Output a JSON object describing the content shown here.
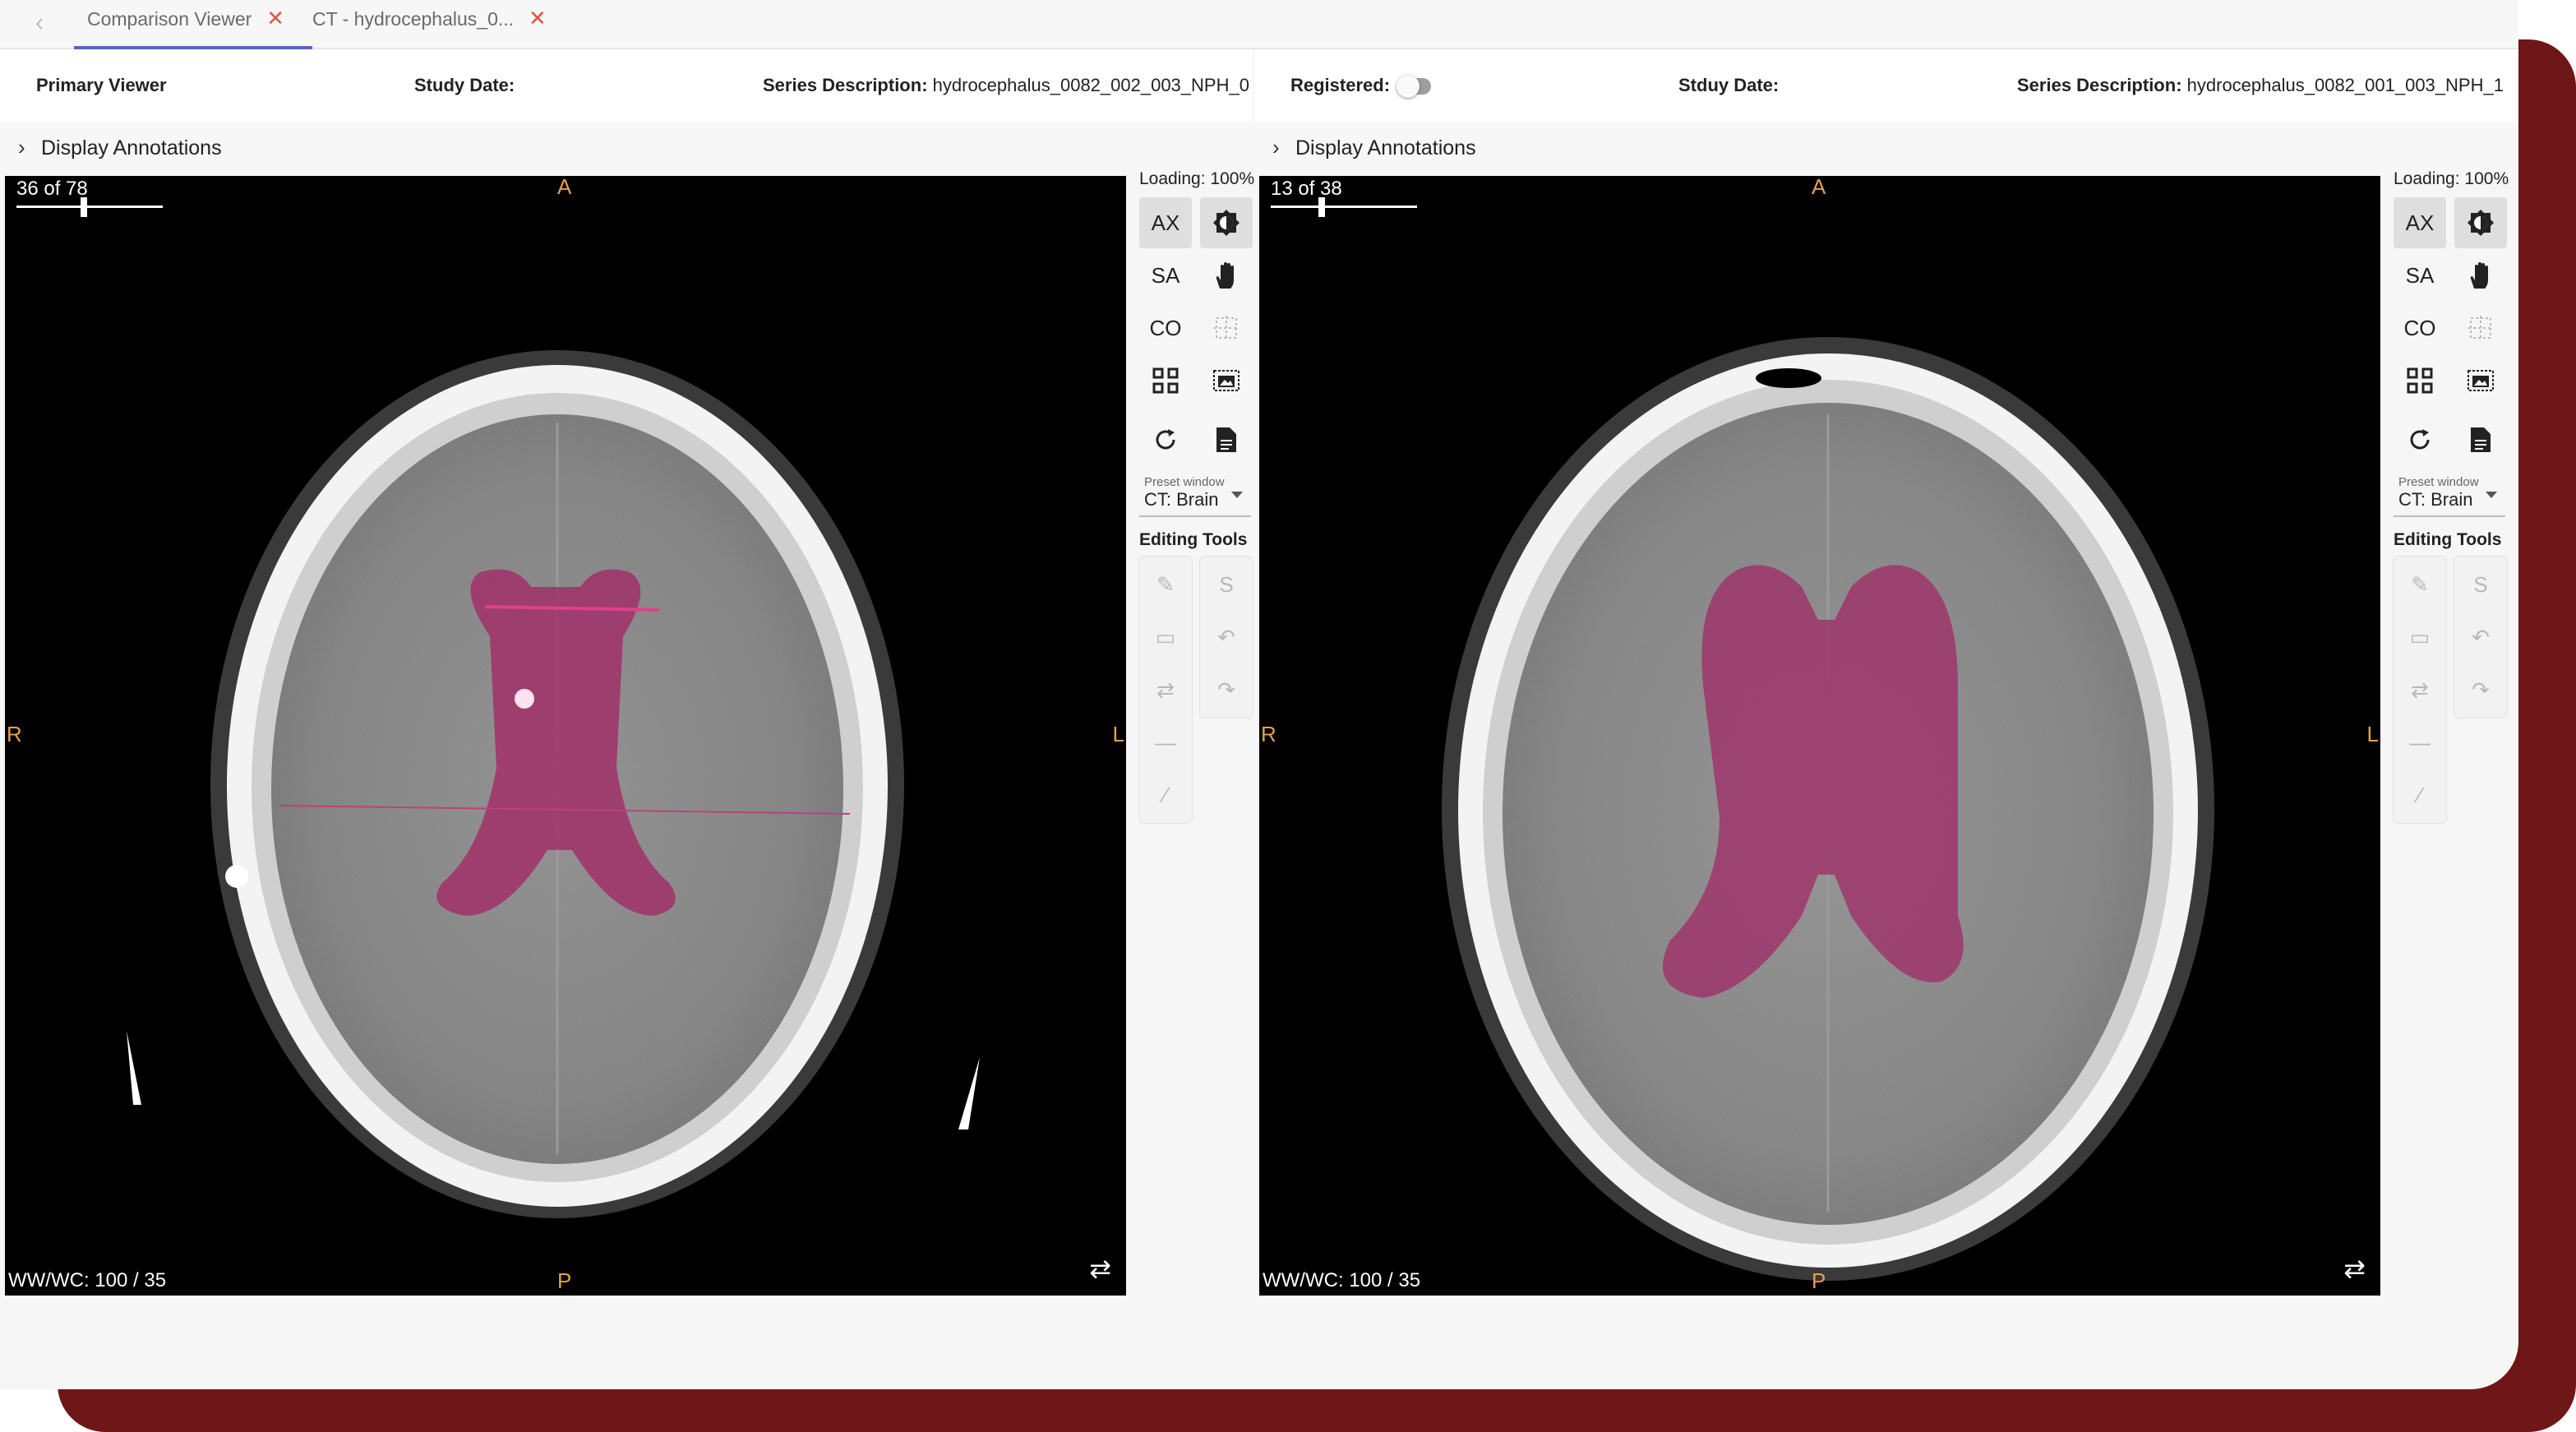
{
  "tabs": [
    {
      "label": "Comparison Viewer",
      "active": true
    },
    {
      "label": "CT - hydrocephalus_0...",
      "active": false
    }
  ],
  "left": {
    "title": "Primary Viewer",
    "study_date_label": "Study Date:",
    "series_label": "Series Description:",
    "series_value": "hydrocephalus_0082_002_003_NPH_0",
    "annotations_label": "Display Annotations",
    "counter": "36 of 78",
    "slider_fraction": 0.46,
    "orient": {
      "top": "A",
      "bottom": "P",
      "left": "R",
      "right": "L"
    },
    "wwwc": "WW/WC: 100 / 35",
    "loading": "Loading: 100%",
    "views": [
      "AX",
      "SA",
      "CO"
    ],
    "preset_label": "Preset window",
    "preset_value": "CT: Brain",
    "editing_title": "Editing Tools",
    "editing_letter": "S"
  },
  "right": {
    "registered_label": "Registered:",
    "registered_on": false,
    "study_date_label": "Stduy Date:",
    "series_label": "Series Description:",
    "series_value": "hydrocephalus_0082_001_003_NPH_1",
    "annotations_label": "Display Annotations",
    "counter": "13 of 38",
    "slider_fraction": 0.34,
    "orient": {
      "top": "A",
      "bottom": "P",
      "left": "R",
      "right": "L"
    },
    "wwwc": "WW/WC: 100 / 35",
    "loading": "Loading: 100%",
    "views": [
      "AX",
      "SA",
      "CO"
    ],
    "preset_label": "Preset window",
    "preset_value": "CT: Brain",
    "editing_title": "Editing Tools",
    "editing_letter": "S"
  },
  "icons": {
    "back": "chevron-left-icon",
    "close": "close-icon",
    "expand": "chevron-right-icon",
    "contrast": "contrast-icon",
    "pan": "hand-icon",
    "crosshair": "crosshair-icon",
    "layout": "grid-layout-icon",
    "capture": "image-capture-icon",
    "reset": "refresh-icon",
    "report": "document-icon",
    "brush": "brush-icon",
    "rectangle": "rectangle-icon",
    "interpolate": "arrows-swap-icon",
    "line": "line-icon",
    "magic": "magic-wand-icon",
    "undo": "undo-icon",
    "redo": "redo-icon",
    "swap": "swap-icon"
  },
  "colors": {
    "accent": "#5964c4",
    "close": "#e0553c",
    "orientation": "#e5a04a",
    "segmentation": "#b0306e",
    "frame": "#6f1618"
  }
}
